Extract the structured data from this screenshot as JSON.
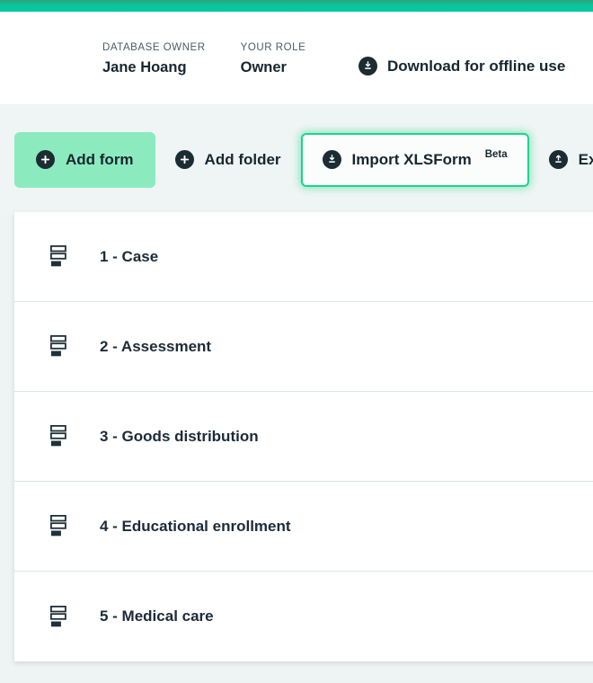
{
  "top_bar": {
    "color": "#00c8a5"
  },
  "header": {
    "database_owner_label": "DATABASE OWNER",
    "database_owner_value": "Jane Hoang",
    "your_role_label": "YOUR ROLE",
    "your_role_value": "Owner",
    "download_label": "Download for offline use",
    "download_icon": "download-circle-icon"
  },
  "toolbar": {
    "background": "#eff5f4",
    "buttons": [
      {
        "label": "Add form",
        "icon": "plus-circle-icon",
        "style": "primary",
        "accent": "#8cebbe"
      },
      {
        "label": "Add folder",
        "icon": "plus-circle-icon",
        "style": "plain",
        "accent": ""
      },
      {
        "label": "Import XLSForm",
        "icon": "download-circle-icon",
        "style": "focused",
        "accent": "#1fd38a",
        "superscript": "Beta"
      },
      {
        "label": "Export",
        "icon": "upload-circle-icon",
        "style": "plain",
        "accent": ""
      }
    ]
  },
  "list": {
    "icon": "form-stack-icon",
    "items": [
      {
        "label": "1 - Case"
      },
      {
        "label": "2 - Assessment"
      },
      {
        "label": "3 - Goods distribution"
      },
      {
        "label": "4 - Educational enrollment"
      },
      {
        "label": "5 - Medical care"
      }
    ]
  }
}
